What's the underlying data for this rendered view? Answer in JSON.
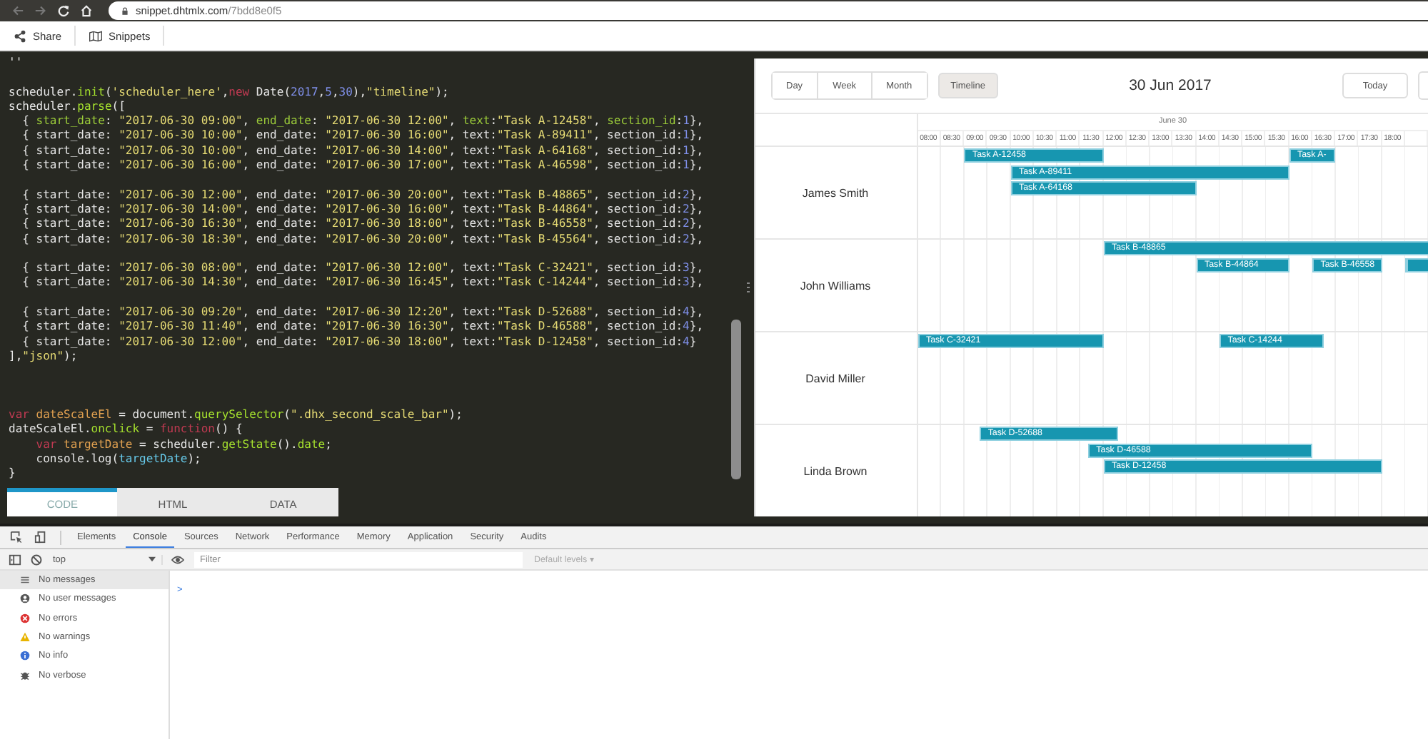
{
  "browser": {
    "url_host": "snippet.dhtmlx.com",
    "url_path": "/7bdd8e0f5"
  },
  "toolbar": [
    {
      "kind": "share",
      "label": "Share"
    },
    {
      "kind": "snippets",
      "label": "Snippets"
    }
  ],
  "code": [
    {
      "kind": "first",
      "lines": [
        [
          {
            "kind": "plain",
            "text": "''"
          }
        ]
      ]
    },
    {
      "kind": "near",
      "lines": [
        [
          {
            "kind": "plain",
            "text": "scheduler."
          },
          {
            "kind": "func",
            "text": "init"
          },
          {
            "kind": "plain",
            "text": "("
          },
          {
            "kind": "string",
            "text": "'scheduler_here'"
          },
          {
            "kind": "plain",
            "text": ","
          },
          {
            "kind": "keyword",
            "text": "new"
          },
          {
            "kind": "plain",
            "text": " Date("
          },
          {
            "kind": "number",
            "text": "2017"
          },
          {
            "kind": "plain",
            "text": ","
          },
          {
            "kind": "number",
            "text": "5"
          },
          {
            "kind": "plain",
            "text": ","
          },
          {
            "kind": "number",
            "text": "30"
          },
          {
            "kind": "plain",
            "text": "),"
          },
          {
            "kind": "string",
            "text": "\"timeline\""
          },
          {
            "kind": "plain",
            "text": ");"
          }
        ],
        [
          {
            "kind": "plain",
            "text": "scheduler."
          },
          {
            "kind": "func",
            "text": "parse"
          },
          {
            "kind": "plain",
            "text": "(["
          }
        ],
        [
          {
            "kind": "plain",
            "text": "  { "
          },
          {
            "kind": "prop",
            "text": "start_date"
          },
          {
            "kind": "plain",
            "text": ": "
          },
          {
            "kind": "string",
            "text": "\"2017-06-30 09:00\""
          },
          {
            "kind": "plain",
            "text": ", "
          },
          {
            "kind": "prop",
            "text": "end_date"
          },
          {
            "kind": "plain",
            "text": ": "
          },
          {
            "kind": "string",
            "text": "\"2017-06-30 12:00\""
          },
          {
            "kind": "plain",
            "text": ", "
          },
          {
            "kind": "prop",
            "text": "text"
          },
          {
            "kind": "plain",
            "text": ":"
          },
          {
            "kind": "string",
            "text": "\"Task A-12458\""
          },
          {
            "kind": "plain",
            "text": ", "
          },
          {
            "kind": "prop",
            "text": "section_id"
          },
          {
            "kind": "plain",
            "text": ":"
          },
          {
            "kind": "number",
            "text": "1"
          },
          {
            "kind": "plain",
            "text": "},"
          }
        ],
        [
          {
            "kind": "plain",
            "text": "  { start_date: "
          },
          {
            "kind": "string",
            "text": "\"2017-06-30 10:00\""
          },
          {
            "kind": "plain",
            "text": ", end_date: "
          },
          {
            "kind": "string",
            "text": "\"2017-06-30 16:00\""
          },
          {
            "kind": "plain",
            "text": ", text:"
          },
          {
            "kind": "string",
            "text": "\"Task A-89411\""
          },
          {
            "kind": "plain",
            "text": ", section_id:"
          },
          {
            "kind": "number",
            "text": "1"
          },
          {
            "kind": "plain",
            "text": "},"
          }
        ],
        [
          {
            "kind": "plain",
            "text": "  { start_date: "
          },
          {
            "kind": "string",
            "text": "\"2017-06-30 10:00\""
          },
          {
            "kind": "plain",
            "text": ", end_date: "
          },
          {
            "kind": "string",
            "text": "\"2017-06-30 14:00\""
          },
          {
            "kind": "plain",
            "text": ", text:"
          },
          {
            "kind": "string",
            "text": "\"Task A-64168\""
          },
          {
            "kind": "plain",
            "text": ", section_id:"
          },
          {
            "kind": "number",
            "text": "1"
          },
          {
            "kind": "plain",
            "text": "},"
          }
        ],
        [
          {
            "kind": "plain",
            "text": "  { start_date: "
          },
          {
            "kind": "string",
            "text": "\"2017-06-30 16:00\""
          },
          {
            "kind": "plain",
            "text": ", end_date: "
          },
          {
            "kind": "string",
            "text": "\"2017-06-30 17:00\""
          },
          {
            "kind": "plain",
            "text": ", text:"
          },
          {
            "kind": "string",
            "text": "\"Task A-46598\""
          },
          {
            "kind": "plain",
            "text": ", section_id:"
          },
          {
            "kind": "number",
            "text": "1"
          },
          {
            "kind": "plain",
            "text": "},"
          }
        ]
      ]
    },
    {
      "kind": "near",
      "lines": [
        [
          {
            "kind": "plain",
            "text": "  { start_date: "
          },
          {
            "kind": "string",
            "text": "\"2017-06-30 12:00\""
          },
          {
            "kind": "plain",
            "text": ", end_date: "
          },
          {
            "kind": "string",
            "text": "\"2017-06-30 20:00\""
          },
          {
            "kind": "plain",
            "text": ", text:"
          },
          {
            "kind": "string",
            "text": "\"Task B-48865\""
          },
          {
            "kind": "plain",
            "text": ", section_id:"
          },
          {
            "kind": "number",
            "text": "2"
          },
          {
            "kind": "plain",
            "text": "},"
          }
        ],
        [
          {
            "kind": "plain",
            "text": "  { start_date: "
          },
          {
            "kind": "string",
            "text": "\"2017-06-30 14:00\""
          },
          {
            "kind": "plain",
            "text": ", end_date: "
          },
          {
            "kind": "string",
            "text": "\"2017-06-30 16:00\""
          },
          {
            "kind": "plain",
            "text": ", text:"
          },
          {
            "kind": "string",
            "text": "\"Task B-44864\""
          },
          {
            "kind": "plain",
            "text": ", section_id:"
          },
          {
            "kind": "number",
            "text": "2"
          },
          {
            "kind": "plain",
            "text": "},"
          }
        ],
        [
          {
            "kind": "plain",
            "text": "  { start_date: "
          },
          {
            "kind": "string",
            "text": "\"2017-06-30 16:30\""
          },
          {
            "kind": "plain",
            "text": ", end_date: "
          },
          {
            "kind": "string",
            "text": "\"2017-06-30 18:00\""
          },
          {
            "kind": "plain",
            "text": ", text:"
          },
          {
            "kind": "string",
            "text": "\"Task B-46558\""
          },
          {
            "kind": "plain",
            "text": ", section_id:"
          },
          {
            "kind": "number",
            "text": "2"
          },
          {
            "kind": "plain",
            "text": "},"
          }
        ],
        [
          {
            "kind": "plain",
            "text": "  { start_date: "
          },
          {
            "kind": "string",
            "text": "\"2017-06-30 18:30\""
          },
          {
            "kind": "plain",
            "text": ", end_date: "
          },
          {
            "kind": "string",
            "text": "\"2017-06-30 20:00\""
          },
          {
            "kind": "plain",
            "text": ", text:"
          },
          {
            "kind": "string",
            "text": "\"Task B-45564\""
          },
          {
            "kind": "plain",
            "text": ", section_id:"
          },
          {
            "kind": "number",
            "text": "2"
          },
          {
            "kind": "plain",
            "text": "},"
          }
        ]
      ]
    },
    {
      "kind": "near",
      "lines": [
        [
          {
            "kind": "plain",
            "text": "  { start_date: "
          },
          {
            "kind": "string",
            "text": "\"2017-06-30 08:00\""
          },
          {
            "kind": "plain",
            "text": ", end_date: "
          },
          {
            "kind": "string",
            "text": "\"2017-06-30 12:00\""
          },
          {
            "kind": "plain",
            "text": ", text:"
          },
          {
            "kind": "string",
            "text": "\"Task C-32421\""
          },
          {
            "kind": "plain",
            "text": ", section_id:"
          },
          {
            "kind": "number",
            "text": "3"
          },
          {
            "kind": "plain",
            "text": "},"
          }
        ],
        [
          {
            "kind": "plain",
            "text": "  { start_date: "
          },
          {
            "kind": "string",
            "text": "\"2017-06-30 14:30\""
          },
          {
            "kind": "plain",
            "text": ", end_date: "
          },
          {
            "kind": "string",
            "text": "\"2017-06-30 16:45\""
          },
          {
            "kind": "plain",
            "text": ", text:"
          },
          {
            "kind": "string",
            "text": "\"Task C-14244\""
          },
          {
            "kind": "plain",
            "text": ", section_id:"
          },
          {
            "kind": "number",
            "text": "3"
          },
          {
            "kind": "plain",
            "text": "},"
          }
        ]
      ]
    },
    {
      "kind": "near",
      "lines": [
        [
          {
            "kind": "plain",
            "text": "  { start_date: "
          },
          {
            "kind": "string",
            "text": "\"2017-06-30 09:20\""
          },
          {
            "kind": "plain",
            "text": ", end_date: "
          },
          {
            "kind": "string",
            "text": "\"2017-06-30 12:20\""
          },
          {
            "kind": "plain",
            "text": ", text:"
          },
          {
            "kind": "string",
            "text": "\"Task D-52688\""
          },
          {
            "kind": "plain",
            "text": ", section_id:"
          },
          {
            "kind": "number",
            "text": "4"
          },
          {
            "kind": "plain",
            "text": "},"
          }
        ],
        [
          {
            "kind": "plain",
            "text": "  { start_date: "
          },
          {
            "kind": "string",
            "text": "\"2017-06-30 11:40\""
          },
          {
            "kind": "plain",
            "text": ", end_date: "
          },
          {
            "kind": "string",
            "text": "\"2017-06-30 16:30\""
          },
          {
            "kind": "plain",
            "text": ", text:"
          },
          {
            "kind": "string",
            "text": "\"Task D-46588\""
          },
          {
            "kind": "plain",
            "text": ", section_id:"
          },
          {
            "kind": "number",
            "text": "4"
          },
          {
            "kind": "plain",
            "text": "},"
          }
        ],
        [
          {
            "kind": "plain",
            "text": "  { start_date: "
          },
          {
            "kind": "string",
            "text": "\"2017-06-30 12:00\""
          },
          {
            "kind": "plain",
            "text": ", end_date: "
          },
          {
            "kind": "string",
            "text": "\"2017-06-30 18:00\""
          },
          {
            "kind": "plain",
            "text": ", text:"
          },
          {
            "kind": "string",
            "text": "\"Task D-12458\""
          },
          {
            "kind": "plain",
            "text": ", section_id:"
          },
          {
            "kind": "number",
            "text": "4"
          },
          {
            "kind": "plain",
            "text": "}"
          }
        ],
        [
          {
            "kind": "plain",
            "text": "],"
          },
          {
            "kind": "string",
            "text": "\"json\""
          },
          {
            "kind": "plain",
            "text": ");"
          }
        ]
      ]
    },
    {
      "kind": "far",
      "lines": [
        [
          {
            "kind": "keyword",
            "text": "var "
          },
          {
            "kind": "variable",
            "text": "dateScaleEl"
          },
          {
            "kind": "plain",
            "text": " = document."
          },
          {
            "kind": "func",
            "text": "querySelector"
          },
          {
            "kind": "plain",
            "text": "("
          },
          {
            "kind": "string",
            "text": "\".dhx_second_scale_bar\""
          },
          {
            "kind": "plain",
            "text": ");"
          }
        ],
        [
          {
            "kind": "plain",
            "text": "dateScaleEl."
          },
          {
            "kind": "func",
            "text": "onclick"
          },
          {
            "kind": "plain",
            "text": " = "
          },
          {
            "kind": "keyword",
            "text": "function"
          },
          {
            "kind": "plain",
            "text": "() {"
          }
        ],
        [
          {
            "kind": "keyword",
            "text": "    var "
          },
          {
            "kind": "variable",
            "text": "targetDate"
          },
          {
            "kind": "plain",
            "text": " = scheduler."
          },
          {
            "kind": "func",
            "text": "getState"
          },
          {
            "kind": "plain",
            "text": "()."
          },
          {
            "kind": "func",
            "text": "date"
          },
          {
            "kind": "plain",
            "text": ";"
          }
        ],
        [
          {
            "kind": "plain",
            "text": "    console.log("
          },
          {
            "kind": "ref",
            "text": "targetDate"
          },
          {
            "kind": "plain",
            "text": ");"
          }
        ],
        [
          {
            "kind": "plain",
            "text": "}"
          }
        ]
      ]
    }
  ],
  "editor_tabs": [
    {
      "label": "CODE",
      "selected": true
    },
    {
      "label": "HTML",
      "selected": false
    },
    {
      "label": "DATA",
      "selected": false
    }
  ],
  "scheduler": {
    "view_tabs": [
      {
        "label": "Day",
        "selected": false
      },
      {
        "label": "Week",
        "selected": false
      },
      {
        "label": "Month",
        "selected": false
      }
    ],
    "timeline_tab": {
      "label": "Timeline",
      "selected": true
    },
    "date": "30 Jun 2017",
    "today": "Today",
    "scale_date": "June 30",
    "times": [
      "08:00",
      "08:30",
      "09:00",
      "09:30",
      "10:00",
      "10:30",
      "11:00",
      "11:30",
      "12:00",
      "12:30",
      "13:00",
      "13:30",
      "14:00",
      "14:30",
      "15:00",
      "15:30",
      "16:00",
      "16:30",
      "17:00",
      "17:30",
      "18:00"
    ],
    "sections": [
      {
        "name": "James Smith",
        "lanes": [
          [
            {
              "label": "Task A-12458"
            },
            {
              "label": "Task A-"
            }
          ],
          [
            {
              "label": "Task A-89411"
            }
          ],
          [
            {
              "label": "Task A-64168"
            }
          ]
        ]
      },
      {
        "name": "John Williams",
        "lanes": [
          [
            {
              "label": "Task B-48865"
            }
          ],
          [
            {
              "label": "Task B-44864"
            },
            {
              "label": "Task B-46558"
            },
            {
              "kind": "cut"
            }
          ]
        ]
      },
      {
        "name": "David Miller",
        "lanes": [
          [
            {
              "label": "Task C-32421"
            },
            {
              "label": "Task C-14244"
            }
          ]
        ]
      },
      {
        "name": "Linda Brown",
        "lanes": [
          [
            {
              "label": "Task D-52688"
            }
          ],
          [
            {
              "label": "Task D-46588"
            }
          ],
          [
            {
              "label": "Task D-12458"
            }
          ]
        ]
      }
    ]
  },
  "devtools": {
    "tabs": [
      {
        "label": "Elements",
        "selected": false
      },
      {
        "label": "Console",
        "selected": true
      },
      {
        "label": "Sources",
        "selected": false
      },
      {
        "label": "Network",
        "selected": false
      },
      {
        "label": "Performance",
        "selected": false
      },
      {
        "label": "Memory",
        "selected": false
      },
      {
        "label": "Application",
        "selected": false
      },
      {
        "label": "Security",
        "selected": false
      },
      {
        "label": "Audits",
        "selected": false
      }
    ],
    "context": "top",
    "filter_placeholder": "Filter",
    "levels": "Default levels ▾",
    "sidebar": [
      {
        "kind": "messages",
        "label": "No messages",
        "selected": true
      },
      {
        "kind": "user",
        "label": "No user messages",
        "selected": false
      },
      {
        "kind": "errors",
        "label": "No errors",
        "selected": false
      },
      {
        "kind": "warnings",
        "label": "No warnings",
        "selected": false
      },
      {
        "kind": "info",
        "label": "No info",
        "selected": false
      },
      {
        "kind": "verbose",
        "label": "No verbose",
        "selected": false
      }
    ],
    "prompt": ">"
  }
}
